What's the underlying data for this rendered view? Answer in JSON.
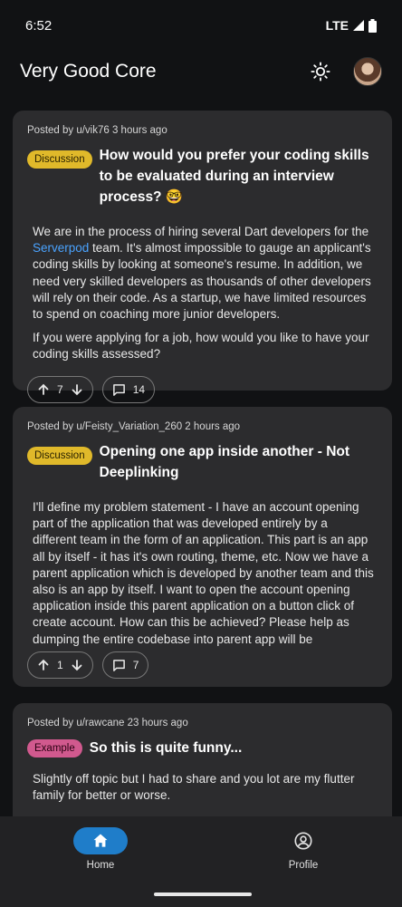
{
  "status_bar": {
    "time": "6:52",
    "network": "LTE"
  },
  "app_bar": {
    "title": "Very Good Core"
  },
  "posts": [
    {
      "posted": "Posted by u/vik76 3 hours ago",
      "badge": "Discussion",
      "title": "How would you prefer your coding skills to be evaluated during an interview process? 🤓",
      "body_before_link": "We are in the process of hiring several Dart developers for the ",
      "body_link": "Serverpod",
      "body_after_link": " team. It's almost impossible to gauge an applicant's coding skills by looking at someone's resume. In addition, we need very skilled developers as thousands of other developers will rely on their code. As a startup, we have limited resources to spend on coaching more junior developers.",
      "body_2": "If you were applying for a job, how would you like to have your coding skills assessed?",
      "votes": "7",
      "comments": "14"
    },
    {
      "posted": "Posted by u/Feisty_Variation_260 2 hours ago",
      "badge": "Discussion",
      "title": "Opening one app inside another - Not Deeplinking",
      "body": "I'll define my problem statement - I have an account opening part of the application that was developed entirely by a different team in the form of an application. This part is an app all by itself - it has it's own routing, theme, etc. Now we have a parent application which is developed by another team and this also is an app by itself. I want to open the account opening application inside this parent application on a button click of create account. How can this be achieved? Please help as dumping the entire codebase into parent app will be",
      "votes": "1",
      "comments": "7"
    },
    {
      "posted": "Posted by u/rawcane 23 hours ago",
      "badge": "Example",
      "title": "So this is quite funny...",
      "body": "Slightly off topic but I had to share and you lot are my flutter family for better or worse."
    }
  ],
  "bottom_nav": {
    "items": [
      {
        "label": "Home",
        "icon": "home-icon",
        "active": true
      },
      {
        "label": "Profile",
        "icon": "account-circle-icon",
        "active": false
      }
    ]
  },
  "colors": {
    "accent": "#1f7dc9",
    "discussion_badge": "#e0b92a",
    "example_badge": "#d1598e",
    "link": "#4aa3ff",
    "card": "#2c2c2e",
    "background": "#111214"
  }
}
